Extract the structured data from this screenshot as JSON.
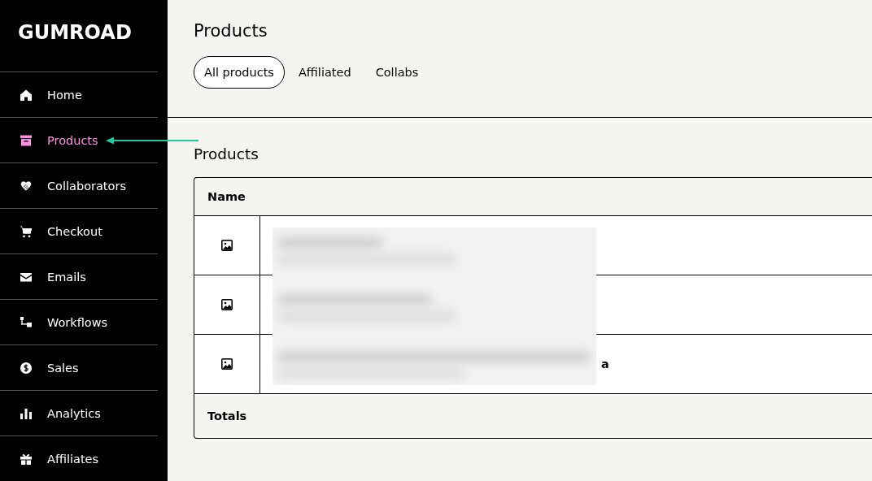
{
  "logo": "GUMROAD",
  "nav": [
    {
      "label": "Home",
      "selected": false
    },
    {
      "label": "Products",
      "selected": true
    },
    {
      "label": "Collaborators",
      "selected": false
    },
    {
      "label": "Checkout",
      "selected": false
    },
    {
      "label": "Emails",
      "selected": false
    },
    {
      "label": "Workflows",
      "selected": false
    },
    {
      "label": "Sales",
      "selected": false
    },
    {
      "label": "Analytics",
      "selected": false
    },
    {
      "label": "Affiliates",
      "selected": false
    }
  ],
  "page_title": "Products",
  "tabs": [
    {
      "label": "All products",
      "selected": true
    },
    {
      "label": "Affiliated",
      "selected": false
    },
    {
      "label": "Collabs",
      "selected": false
    }
  ],
  "section_title": "Products",
  "table": {
    "columns": [
      "Name"
    ],
    "rows": [
      {
        "kind": "product"
      },
      {
        "kind": "product"
      },
      {
        "kind": "product",
        "name": "a"
      }
    ],
    "totals_label": "Totals"
  }
}
